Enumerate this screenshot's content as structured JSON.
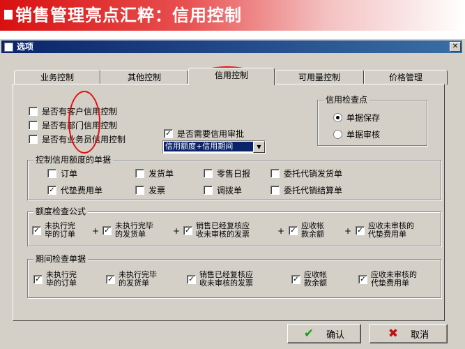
{
  "slide": {
    "title": "销售管理亮点汇粹：信用控制"
  },
  "window": {
    "title": "选项",
    "close_glyph": "✕"
  },
  "tabs": [
    "业务控制",
    "其他控制",
    "信用控制",
    "可用量控制",
    "价格管理"
  ],
  "active_tab": "信用控制",
  "credit_options": [
    {
      "label": "是否有客户信用控制",
      "checked": false
    },
    {
      "label": "是否有部门信用控制",
      "checked": false
    },
    {
      "label": "是否有业务员信用控制",
      "checked": false
    }
  ],
  "credit_mode": {
    "selected": "信用额度+信用期间"
  },
  "audit": {
    "label": "是否需要信用审批",
    "checked": true
  },
  "check_point": {
    "title": "信用检查点",
    "options": [
      {
        "label": "单据保存",
        "selected": true
      },
      {
        "label": "单据审核",
        "selected": false
      }
    ]
  },
  "documents": {
    "title": "控制信用额度的单据",
    "row1": [
      {
        "label": "订单",
        "checked": false
      },
      {
        "label": "发货单",
        "checked": false
      },
      {
        "label": "零售日报",
        "checked": false
      },
      {
        "label": "委托代销发货单",
        "checked": false
      }
    ],
    "row2": [
      {
        "label": "代垫费用单",
        "checked": true
      },
      {
        "label": "发票",
        "checked": false
      },
      {
        "label": "调拨单",
        "checked": false
      },
      {
        "label": "委托代销结算单",
        "checked": false
      }
    ]
  },
  "formula": {
    "title": "额度检查公式",
    "items": [
      {
        "line1": "未执行完",
        "line2": "毕的订单",
        "checked": true
      },
      {
        "line1": "未执行完毕",
        "line2": "的发货单",
        "checked": true
      },
      {
        "line1": "销售已经复核应",
        "line2": "收未审核的发票",
        "checked": true
      },
      {
        "line1": "应收帐",
        "line2": "款余额",
        "checked": true
      },
      {
        "line1": "应收未审核的",
        "line2": "代垫费用单",
        "checked": true
      }
    ],
    "operator": "+"
  },
  "period": {
    "title": "期间检查单据",
    "items": [
      {
        "line1": "未执行完",
        "line2": "毕的订单",
        "checked": true
      },
      {
        "line1": "未执行完毕",
        "line2": "的发货单",
        "checked": true
      },
      {
        "line1": "销售已经复核应",
        "line2": "收未审核的发票",
        "checked": true
      },
      {
        "line1": "应收帐",
        "line2": "款余额",
        "checked": true
      },
      {
        "line1": "应收未审核的",
        "line2": "代垫费用单",
        "checked": true
      }
    ]
  },
  "buttons": {
    "ok": "确认",
    "cancel": "取消"
  },
  "icons": {
    "ok": "checkmark-icon",
    "cancel": "x-icon",
    "check_glyph": "✓",
    "ok_color": "#1a9a1a",
    "cancel_color": "#c01010"
  },
  "colors": {
    "title_bar": "#0a246a",
    "annotation": "#e01010",
    "slide_title_bg": "#d91010"
  }
}
